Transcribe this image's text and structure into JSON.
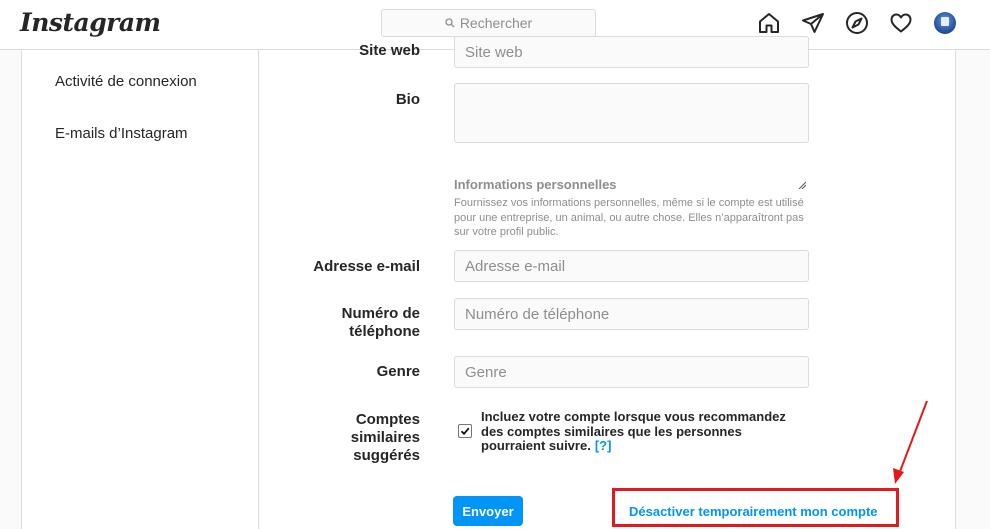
{
  "header": {
    "logo": "Instagram",
    "search_placeholder": "Rechercher",
    "icons": [
      "home-icon",
      "direct-icon",
      "explore-icon",
      "activity-heart-icon",
      "profile-avatar"
    ]
  },
  "sidebar": {
    "items": [
      {
        "label": "Activité de connexion"
      },
      {
        "label": "E-mails d’Instagram"
      }
    ]
  },
  "form": {
    "website": {
      "label": "Site web",
      "placeholder": "Site web",
      "value": ""
    },
    "bio": {
      "label": "Bio",
      "value": ""
    },
    "personal_info": {
      "title": "Informations personnelles",
      "description": "Fournissez vos informations personnelles, même si le compte est utilisé pour une entreprise, un animal, ou autre chose. Elles n’apparaîtront pas sur votre profil public."
    },
    "email": {
      "label": "Adresse e-mail",
      "placeholder": "Adresse e-mail",
      "value": ""
    },
    "phone": {
      "label_line1": "Numéro de",
      "label_line2": "téléphone",
      "placeholder": "Numéro de téléphone",
      "value": ""
    },
    "gender": {
      "label": "Genre",
      "placeholder": "Genre",
      "value": ""
    },
    "suggested": {
      "label_line1": "Comptes",
      "label_line2": "similaires",
      "label_line3": "suggérés",
      "checked": true,
      "text": "Incluez votre compte lorsque vous recommandez des comptes similaires que les personnes pourraient suivre.",
      "help": "[?]"
    },
    "submit_label": "Envoyer",
    "deactivate_label": "Désactiver temporairement mon compte"
  },
  "colors": {
    "accent": "#0095f6",
    "annotation": "#e4191c",
    "border": "#dbdbdb"
  }
}
